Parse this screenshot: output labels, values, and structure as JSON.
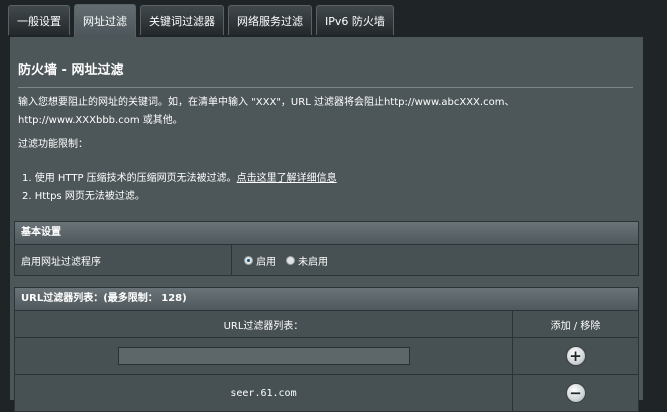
{
  "tabs": [
    {
      "label": "一般设置",
      "active": false
    },
    {
      "label": "网址过滤",
      "active": true
    },
    {
      "label": "关键词过滤器",
      "active": false
    },
    {
      "label": "网络服务过滤",
      "active": false
    },
    {
      "label": "IPv6 防火墙",
      "active": false
    }
  ],
  "page": {
    "title": "防火墙 - 网址过滤",
    "description_line1": "输入您想要阻止的网址的关键词。如，在清单中输入 \"XXX\"，URL 过滤器将会阻止http://www.abcXXX.com、",
    "description_line2": "http://www.XXXbbb.com 或其他。",
    "limits_heading": "过滤功能限制：",
    "limit1_text": "1.   使用 HTTP 压缩技术的压缩网页无法被过滤。",
    "limit1_link": "点击这里了解详细信息",
    "limit2_text": "2.   Https 网页无法被过滤。"
  },
  "basic": {
    "header": "基本设置",
    "label": "启用网址过滤程序",
    "option_on": "启用",
    "option_off": "未启用",
    "selected": "启用"
  },
  "url_list": {
    "header": "URL过滤器列表：(最多限制： 128)",
    "col_list": "URL过滤器列表：",
    "col_action": "添加 / 移除",
    "input_value": "",
    "entries": [
      "seer.61.com"
    ],
    "add_icon": "plus-circle-icon",
    "remove_icon": "minus-circle-icon"
  }
}
